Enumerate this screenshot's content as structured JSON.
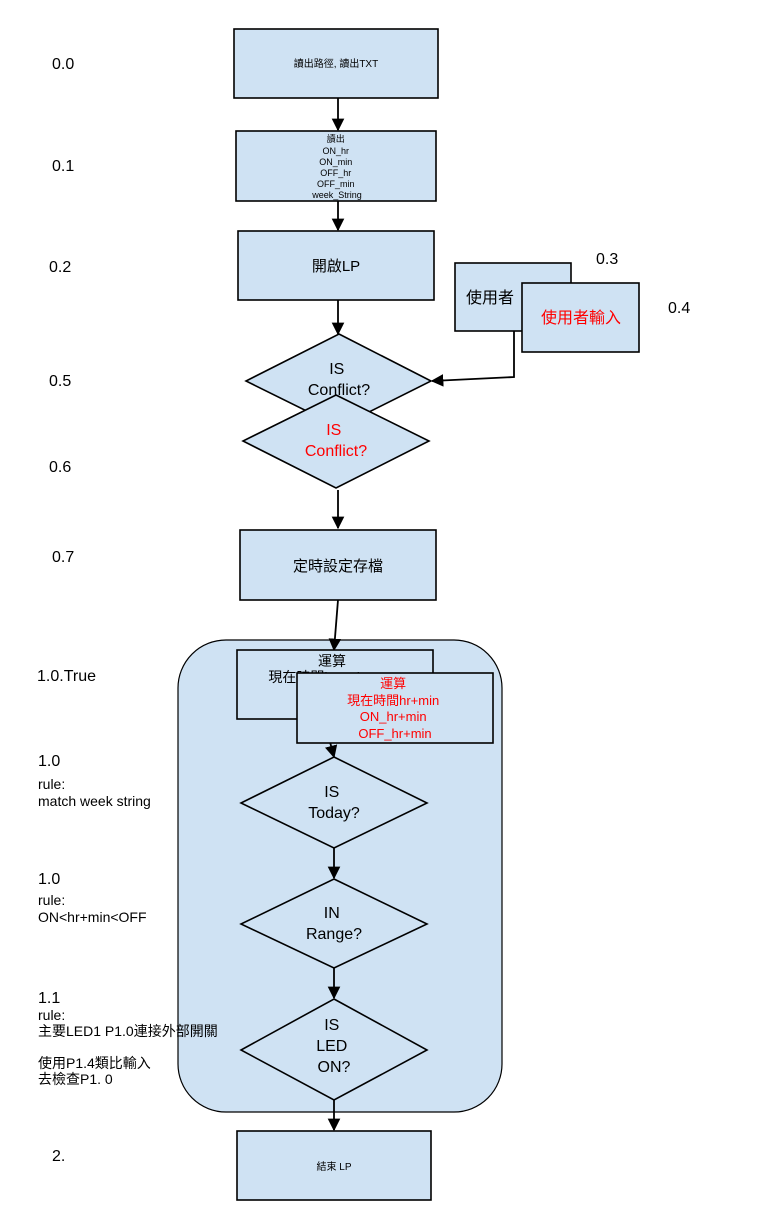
{
  "steps": {
    "s00": {
      "number": "0.0",
      "text": "讀出路徑, 讀出TXT"
    },
    "s01": {
      "number": "0.1",
      "lines": [
        "讀出",
        "ON_hr",
        "ON_min",
        "OFF_hr",
        "OFF_min",
        "week_String"
      ]
    },
    "s02": {
      "number": "0.2",
      "text": "開啟LP"
    },
    "s03": {
      "number": "0.3",
      "text": "使用者"
    },
    "s04": {
      "number": "0.4",
      "text": "使用者輸入"
    },
    "s05": {
      "number": "0.5",
      "lines": [
        "IS",
        "Conflict?"
      ]
    },
    "s06": {
      "number": "0.6",
      "lines": [
        "IS",
        "Conflict?"
      ]
    },
    "s07": {
      "number": "0.7",
      "text": "定時設定存檔"
    },
    "s10true": {
      "number": "1.0.True",
      "back_lines": [
        "運算",
        "現在時間hr+min"
      ],
      "front_lines": [
        "運算",
        "現在時間hr+min",
        "ON_hr+min",
        "OFF_hr+min"
      ]
    },
    "s10a": {
      "number": "1.0",
      "rule_lines": [
        "rule:",
        "match week string"
      ],
      "lines": [
        "IS",
        "Today?"
      ]
    },
    "s10b": {
      "number": "1.0",
      "rule_lines": [
        "rule:",
        "ON<hr+min<OFF"
      ],
      "lines": [
        "IN",
        "Range?"
      ]
    },
    "s11": {
      "number": "1.1",
      "rule_lines": [
        "rule:",
        "主要LED1 P1.0連接外部開關",
        "",
        "使用P1.4類比輸入",
        "去檢查P1. 0"
      ],
      "lines": [
        "IS",
        "LED",
        "ON?"
      ]
    },
    "s2": {
      "number": "2.",
      "text": "結束 LP"
    }
  },
  "colors": {
    "node_fill": "#cfe2f3",
    "highlight_text": "#ff0000",
    "stroke": "#000000"
  }
}
